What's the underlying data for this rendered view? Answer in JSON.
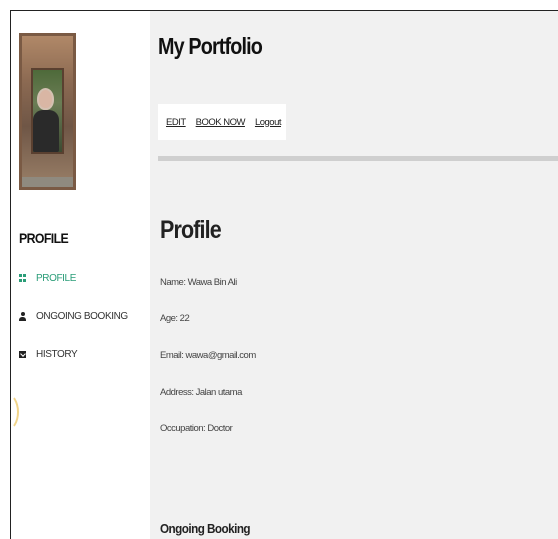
{
  "app": {
    "title": "My Portfolio"
  },
  "toolbar": {
    "items": [
      "EDIT",
      "BOOK NOW",
      "Logout"
    ]
  },
  "sidebar": {
    "heading": "PROFILE",
    "items": [
      {
        "label": "PROFILE",
        "icon": "grid-icon",
        "active": true
      },
      {
        "label": "ONGOING BOOKING",
        "icon": "user-icon",
        "active": false
      },
      {
        "label": "HISTORY",
        "icon": "envelope-icon",
        "active": false
      }
    ]
  },
  "profile": {
    "title": "Profile",
    "fields": [
      "Name: Wawa Bin Ali",
      "Age: 22",
      "Email: wawa@gmail.com",
      "Address: Jalan utama",
      "Occupation: Doctor"
    ]
  },
  "ongoing": {
    "title": "Ongoing Booking"
  },
  "colors": {
    "accent": "#2a9d78",
    "background": "#f1f1f1",
    "divider": "#cfcfcf"
  }
}
